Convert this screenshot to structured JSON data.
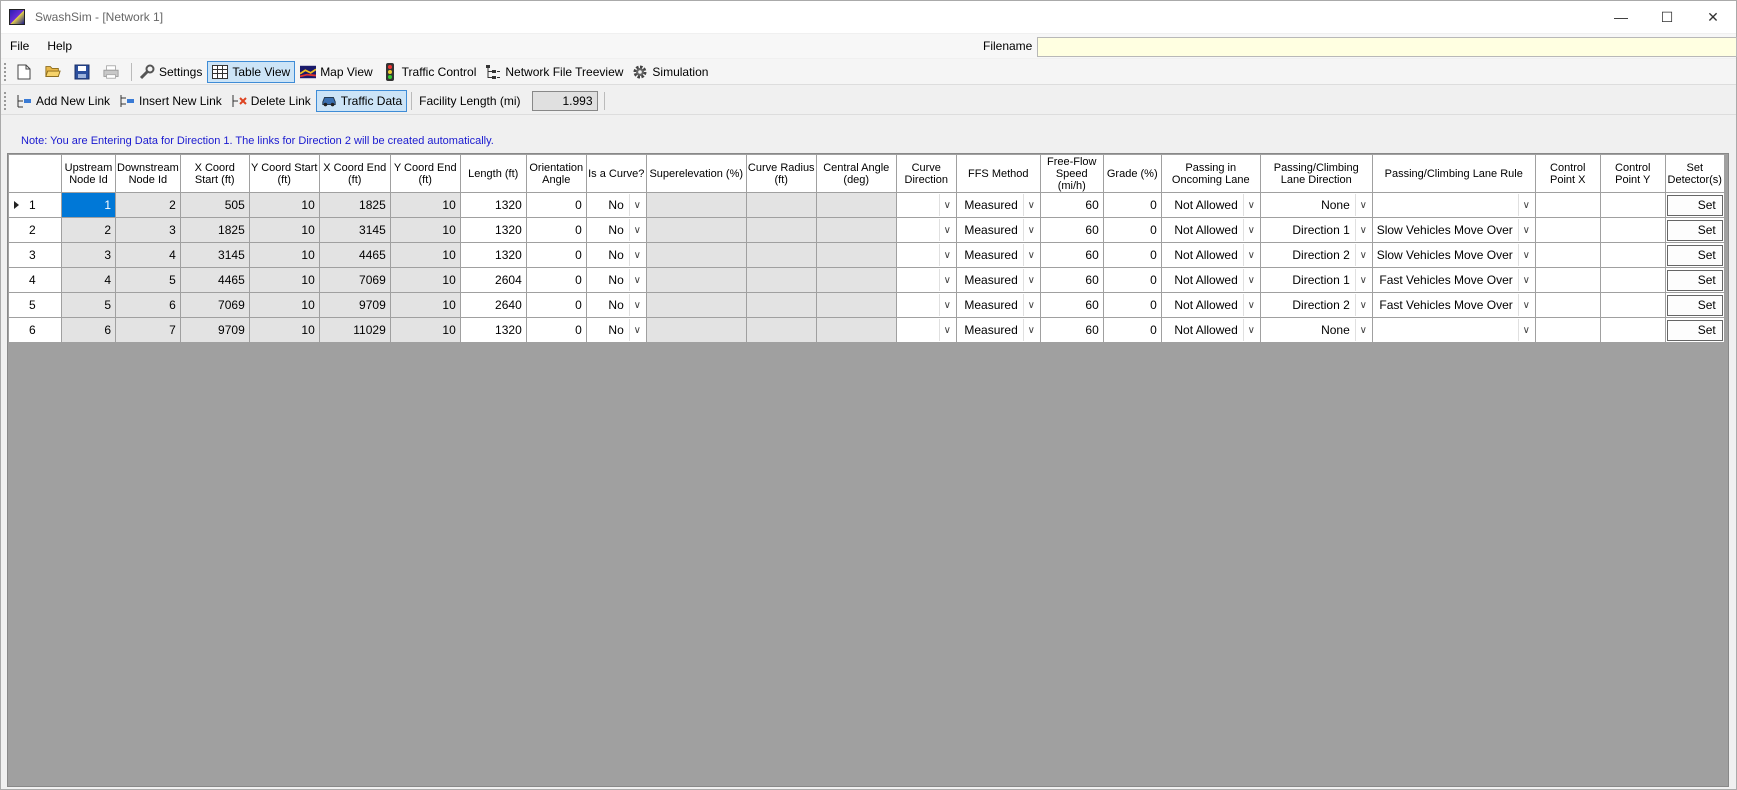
{
  "window": {
    "title": "SwashSim - [Network 1]",
    "minimize": "—",
    "maximize": "☐",
    "close": "✕"
  },
  "menu": {
    "file": "File",
    "help": "Help"
  },
  "filename": {
    "label": "Filename",
    "value": ""
  },
  "toolbar1": {
    "settings": "Settings",
    "table_view": "Table View",
    "map_view": "Map View",
    "traffic_control": "Traffic Control",
    "network_treeview": "Network File Treeview",
    "simulation": "Simulation"
  },
  "toolbar2": {
    "add_link": "Add New Link",
    "insert_link": "Insert New Link",
    "delete_link": "Delete Link",
    "traffic_data": "Traffic Data",
    "facility_length_label": "Facility Length (mi)",
    "facility_length_value": "1.993"
  },
  "note": "Note: You are Entering Data for Direction 1. The links for Direction 2 will be created automatically.",
  "columns": [
    "",
    "Upstream Node Id",
    "Downstream Node Id",
    "X Coord Start (ft)",
    "Y Coord Start (ft)",
    "X Coord End (ft)",
    "Y Coord End (ft)",
    "Length (ft)",
    "Orientation Angle",
    "Is a Curve?",
    "Superelevation (%)",
    "Curve Radius (ft)",
    "Central Angle (deg)",
    "Curve Direction",
    "FFS Method",
    "Free-Flow Speed (mi/h)",
    "Grade (%)",
    "Passing in Oncoming Lane",
    "Passing/Climbing Lane Direction",
    "Passing/Climbing Lane Rule",
    "Control Point X",
    "Control Point Y",
    "Set Detector(s)"
  ],
  "rows": [
    {
      "num": "1",
      "up": "1",
      "down": "2",
      "xs": "505",
      "ys": "10",
      "xe": "1825",
      "ye": "10",
      "len": "1320",
      "orient": "0",
      "curve": "No",
      "ffs_method": "Measured",
      "ffs": "60",
      "grade": "0",
      "passing": "Not Allowed",
      "lane_dir": "None",
      "lane_rule": "",
      "set": "Set"
    },
    {
      "num": "2",
      "up": "2",
      "down": "3",
      "xs": "1825",
      "ys": "10",
      "xe": "3145",
      "ye": "10",
      "len": "1320",
      "orient": "0",
      "curve": "No",
      "ffs_method": "Measured",
      "ffs": "60",
      "grade": "0",
      "passing": "Not Allowed",
      "lane_dir": "Direction 1",
      "lane_rule": "Slow Vehicles Move Over",
      "set": "Set"
    },
    {
      "num": "3",
      "up": "3",
      "down": "4",
      "xs": "3145",
      "ys": "10",
      "xe": "4465",
      "ye": "10",
      "len": "1320",
      "orient": "0",
      "curve": "No",
      "ffs_method": "Measured",
      "ffs": "60",
      "grade": "0",
      "passing": "Not Allowed",
      "lane_dir": "Direction 2",
      "lane_rule": "Slow Vehicles Move Over",
      "set": "Set"
    },
    {
      "num": "4",
      "up": "4",
      "down": "5",
      "xs": "4465",
      "ys": "10",
      "xe": "7069",
      "ye": "10",
      "len": "2604",
      "orient": "0",
      "curve": "No",
      "ffs_method": "Measured",
      "ffs": "60",
      "grade": "0",
      "passing": "Not Allowed",
      "lane_dir": "Direction 1",
      "lane_rule": "Fast Vehicles Move Over",
      "set": "Set"
    },
    {
      "num": "5",
      "up": "5",
      "down": "6",
      "xs": "7069",
      "ys": "10",
      "xe": "9709",
      "ye": "10",
      "len": "2640",
      "orient": "0",
      "curve": "No",
      "ffs_method": "Measured",
      "ffs": "60",
      "grade": "0",
      "passing": "Not Allowed",
      "lane_dir": "Direction 2",
      "lane_rule": "Fast Vehicles Move Over",
      "set": "Set"
    },
    {
      "num": "6",
      "up": "6",
      "down": "7",
      "xs": "9709",
      "ys": "10",
      "xe": "11029",
      "ye": "10",
      "len": "1320",
      "orient": "0",
      "curve": "No",
      "ffs_method": "Measured",
      "ffs": "60",
      "grade": "0",
      "passing": "Not Allowed",
      "lane_dir": "None",
      "lane_rule": "",
      "set": "Set"
    }
  ]
}
